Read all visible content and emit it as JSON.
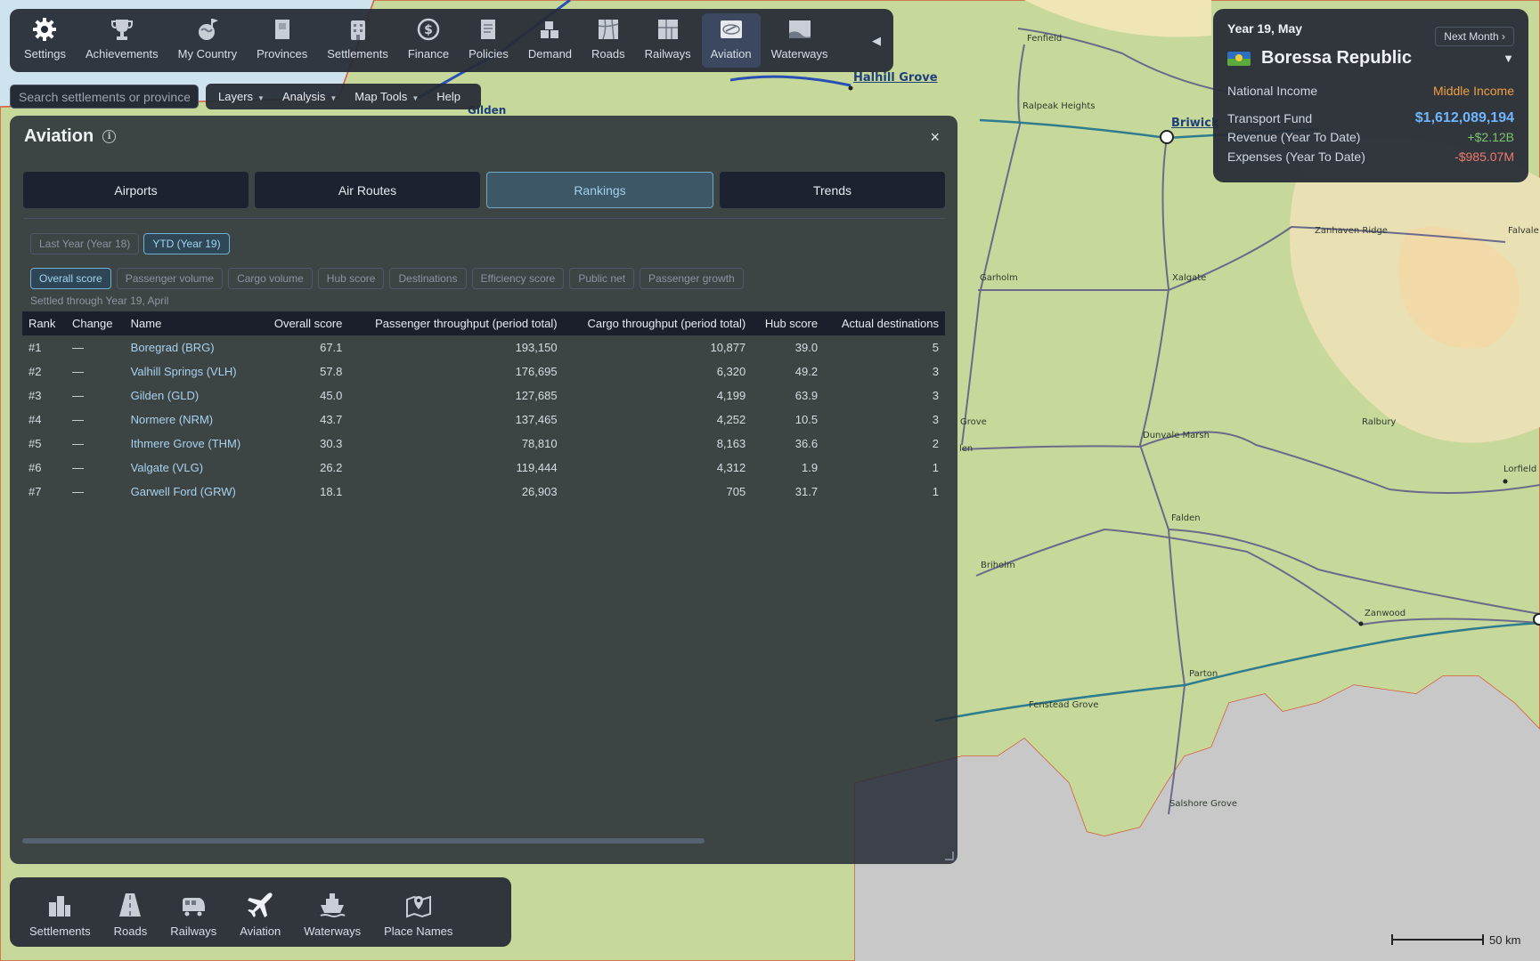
{
  "toolbar": {
    "items": [
      {
        "label": "Settings",
        "icon": "gear-icon"
      },
      {
        "label": "Achievements",
        "icon": "trophy-icon"
      },
      {
        "label": "My Country",
        "icon": "globe-icon"
      },
      {
        "label": "Provinces",
        "icon": "map-pages-icon"
      },
      {
        "label": "Settlements",
        "icon": "buildings-icon"
      },
      {
        "label": "Finance",
        "icon": "dollar-icon"
      },
      {
        "label": "Policies",
        "icon": "document-icon"
      },
      {
        "label": "Demand",
        "icon": "boxes-icon"
      },
      {
        "label": "Roads",
        "icon": "road-map-icon"
      },
      {
        "label": "Railways",
        "icon": "railway-map-icon"
      },
      {
        "label": "Aviation",
        "icon": "aviation-globe-icon"
      },
      {
        "label": "Waterways",
        "icon": "waterway-icon"
      }
    ],
    "collapse": "◀"
  },
  "search": {
    "placeholder": "Search settlements or provinces"
  },
  "menubar": {
    "layers": "Layers",
    "analysis": "Analysis",
    "map_tools": "Map Tools",
    "help": "Help"
  },
  "info": {
    "date": "Year 19, May",
    "next_month": "Next Month ›",
    "country": "Boressa Republic",
    "dropdown": "▼",
    "national_income_label": "National Income",
    "national_income_value": "Middle Income",
    "transport_fund_label": "Transport Fund",
    "transport_fund_value": "$1,612,089,194",
    "revenue_label": "Revenue (Year To Date)",
    "revenue_value": "+$2.12B",
    "expenses_label": "Expenses (Year To Date)",
    "expenses_value": "-$985.07M",
    "colors": {
      "income": "#f0a040",
      "fund": "#6fb6ff",
      "revenue": "#7ac56b",
      "expenses": "#ef7a6a"
    }
  },
  "panel": {
    "title": "Aviation",
    "info_glyph": "i",
    "close": "×",
    "tabs": [
      "Airports",
      "Air Routes",
      "Rankings",
      "Trends"
    ],
    "active_tab": "Rankings",
    "periods": [
      "Last Year (Year 18)",
      "YTD (Year 19)"
    ],
    "active_period": "YTD (Year 19)",
    "metrics": [
      "Overall score",
      "Passenger volume",
      "Cargo volume",
      "Hub score",
      "Destinations",
      "Efficiency score",
      "Public net",
      "Passenger growth"
    ],
    "active_metric": "Overall score",
    "settled": "Settled through Year 19, April",
    "columns": [
      "Rank",
      "Change",
      "Name",
      "Overall score",
      "Passenger throughput (period total)",
      "Cargo throughput (period total)",
      "Hub score",
      "Actual destinations"
    ],
    "rows": [
      [
        "#1",
        "—",
        "Boregrad (BRG)",
        "67.1",
        "193,150",
        "10,877",
        "39.0",
        "5"
      ],
      [
        "#2",
        "—",
        "Valhill Springs (VLH)",
        "57.8",
        "176,695",
        "6,320",
        "49.2",
        "3"
      ],
      [
        "#3",
        "—",
        "Gilden (GLD)",
        "45.0",
        "127,685",
        "4,199",
        "63.9",
        "3"
      ],
      [
        "#4",
        "—",
        "Normere (NRM)",
        "43.7",
        "137,465",
        "4,252",
        "10.5",
        "3"
      ],
      [
        "#5",
        "—",
        "Ithmere Grove (THM)",
        "30.3",
        "78,810",
        "8,163",
        "36.6",
        "2"
      ],
      [
        "#6",
        "—",
        "Valgate (VLG)",
        "26.2",
        "119,444",
        "4,312",
        "1.9",
        "1"
      ],
      [
        "#7",
        "—",
        "Garwell Ford (GRW)",
        "18.1",
        "26,903",
        "705",
        "31.7",
        "1"
      ]
    ]
  },
  "dock": {
    "items": [
      {
        "label": "Settlements",
        "icon": "settlements-layer-icon"
      },
      {
        "label": "Roads",
        "icon": "roads-layer-icon"
      },
      {
        "label": "Railways",
        "icon": "railways-layer-icon"
      },
      {
        "label": "Aviation",
        "icon": "airplane-icon"
      },
      {
        "label": "Waterways",
        "icon": "ship-icon"
      },
      {
        "label": "Place Names",
        "icon": "place-names-icon"
      }
    ]
  },
  "map": {
    "labels": [
      "Fenfield",
      "Halhill Grove",
      "Gilden",
      "Ralpeak Heights",
      "Briwick",
      "Zanhaven Ridge",
      "Falvale",
      "Garholm",
      "Xalgate",
      "Grove",
      "Dunvale Marsh",
      "Ralbury",
      "Lorfield",
      "Falden",
      "Briholm",
      "Zanwood",
      "Parton",
      "Fenstead Grove",
      "Salshore Grove",
      "len"
    ],
    "scale": "50 km"
  }
}
